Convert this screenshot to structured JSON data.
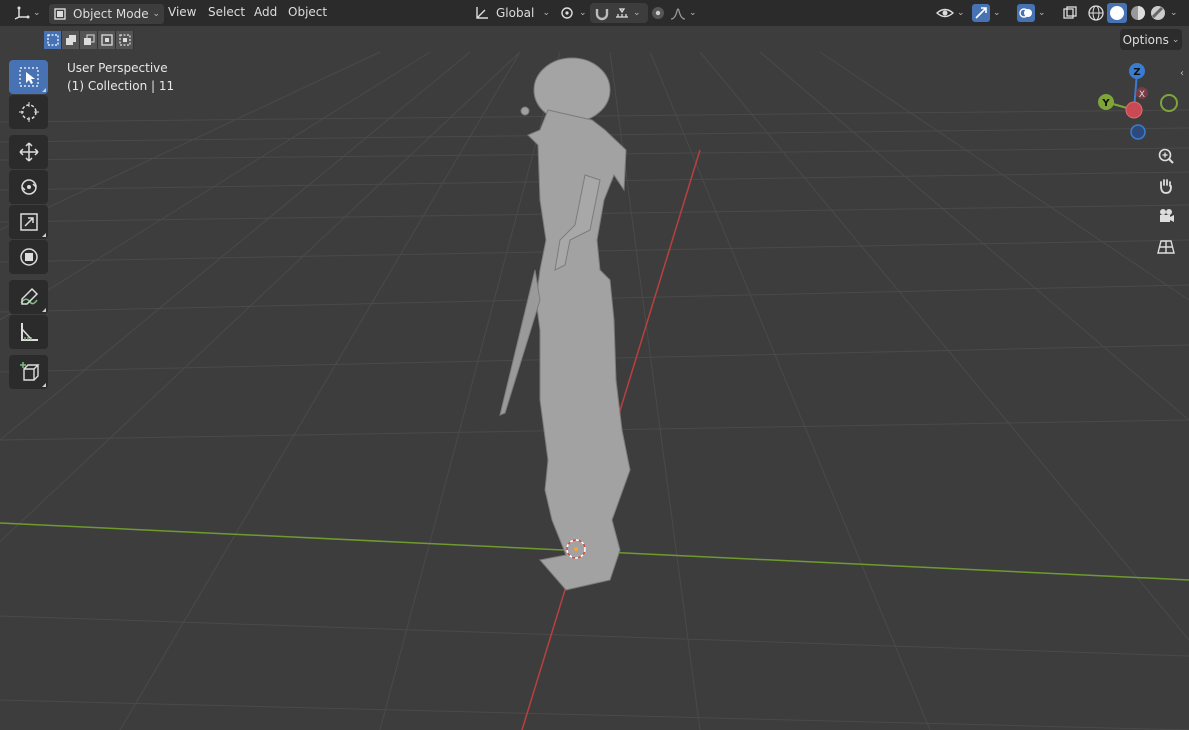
{
  "header": {
    "editor_type_icon": "axis-editor-icon",
    "mode_label": "Object Mode",
    "menu": [
      "View",
      "Select",
      "Add",
      "Object"
    ],
    "orientation_label": "Global"
  },
  "options_label": "Options",
  "viewport": {
    "view_name": "User Perspective",
    "collection_info": "(1) Collection | 11"
  },
  "gizmo": {
    "z_label": "Z",
    "y_label": "Y",
    "x_label": "X",
    "colors": {
      "x": "#c94a52",
      "y": "#7fa53a",
      "z": "#3a7cd2"
    }
  },
  "tools": [
    {
      "name": "select-box-tool",
      "icon": "cursor-select-icon",
      "active": true
    },
    {
      "name": "cursor-tool",
      "icon": "3d-cursor-icon",
      "active": false
    },
    {
      "name": "move-tool",
      "icon": "move-arrows-icon",
      "active": false
    },
    {
      "name": "rotate-tool",
      "icon": "rotate-icon",
      "active": false
    },
    {
      "name": "scale-tool",
      "icon": "scale-icon",
      "active": false
    },
    {
      "name": "transform-tool",
      "icon": "transform-icon",
      "active": false
    },
    {
      "name": "annotate-tool",
      "icon": "annotate-pen-icon",
      "active": false
    },
    {
      "name": "measure-tool",
      "icon": "measure-ruler-icon",
      "active": false
    },
    {
      "name": "add-cube-tool",
      "icon": "add-cube-icon",
      "active": false
    }
  ],
  "colors": {
    "accent": "#4772b3",
    "axis_x_line": "#b8403f",
    "axis_y_line": "#6e9a2e",
    "background": "#3d3d3d"
  }
}
